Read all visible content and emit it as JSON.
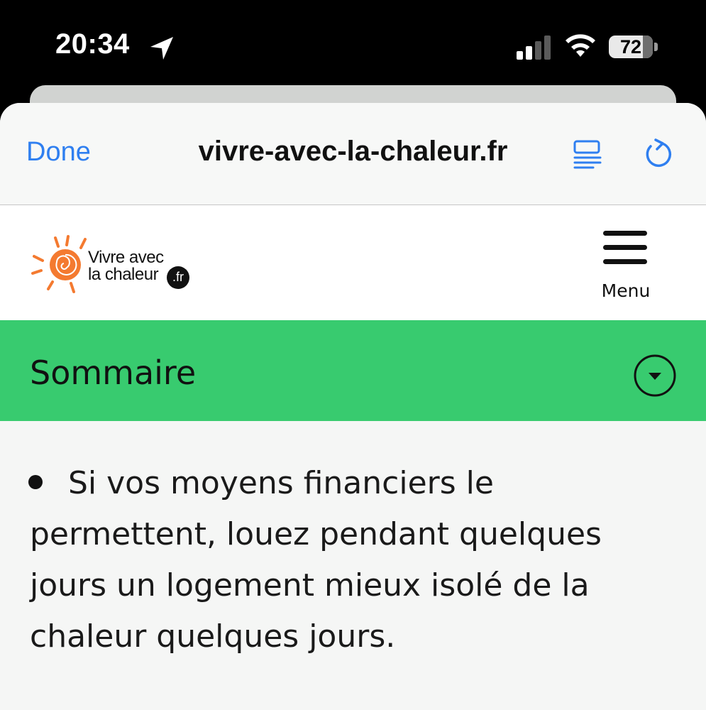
{
  "status_bar": {
    "time": "20:34",
    "battery": "72",
    "icons": [
      "location-arrow-icon",
      "cellular-signal-icon",
      "wifi-icon",
      "battery-icon"
    ]
  },
  "browser": {
    "done_label": "Done",
    "url": "vivre-avec-la-chaleur.fr",
    "accent_color": "#2f7ff0",
    "icons": [
      "reader-mode-icon",
      "reload-icon"
    ]
  },
  "site": {
    "logo_line1": "Vivre avec",
    "logo_line2": "la chaleur",
    "logo_suffix": ".fr",
    "logo_color": "#f47a30",
    "menu_label": "Menu"
  },
  "summary": {
    "title": "Sommaire",
    "color": "#38cb6f"
  },
  "content": {
    "bullet": "Si vos moyens financiers le permettent, louez pendant quelques jours un logement mieux isolé de la chaleur quelques jours."
  }
}
